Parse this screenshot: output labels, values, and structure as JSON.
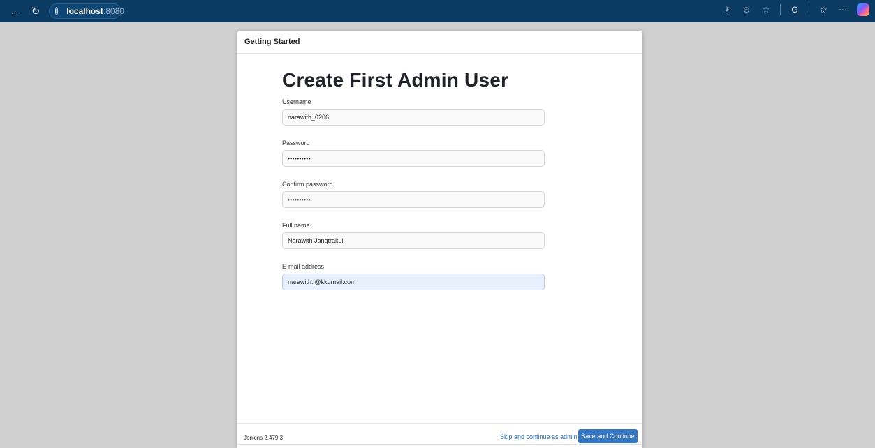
{
  "browser": {
    "host": "localhost",
    "port": ":8080"
  },
  "dialog": {
    "header": "Getting Started",
    "title": "Create First Admin User",
    "fields": [
      {
        "label": "Username",
        "value": "narawith_0206"
      },
      {
        "label": "Password",
        "value": "••••••••••"
      },
      {
        "label": "Confirm password",
        "value": "••••••••••"
      },
      {
        "label": "Full name",
        "value": "Narawith Jangtrakul"
      },
      {
        "label": "E-mail address",
        "value": "narawith.j@kkumail.com"
      }
    ],
    "footer": {
      "version": "Jenkins 2.479.3",
      "skip_label": "Skip and continue as admin",
      "save_label": "Save and Continue"
    }
  },
  "colors": {
    "browser_bar": "#0b3b63",
    "primary_button": "#3476c2",
    "link": "#2c6db3",
    "page_background": "#cfcfcf"
  },
  "icons": [
    "back-arrow-icon",
    "reload-icon",
    "info-icon",
    "key-icon",
    "zoom-icon",
    "favorite-star-icon",
    "extension-icon",
    "favorites-list-icon",
    "more-icon",
    "copilot-icon"
  ]
}
